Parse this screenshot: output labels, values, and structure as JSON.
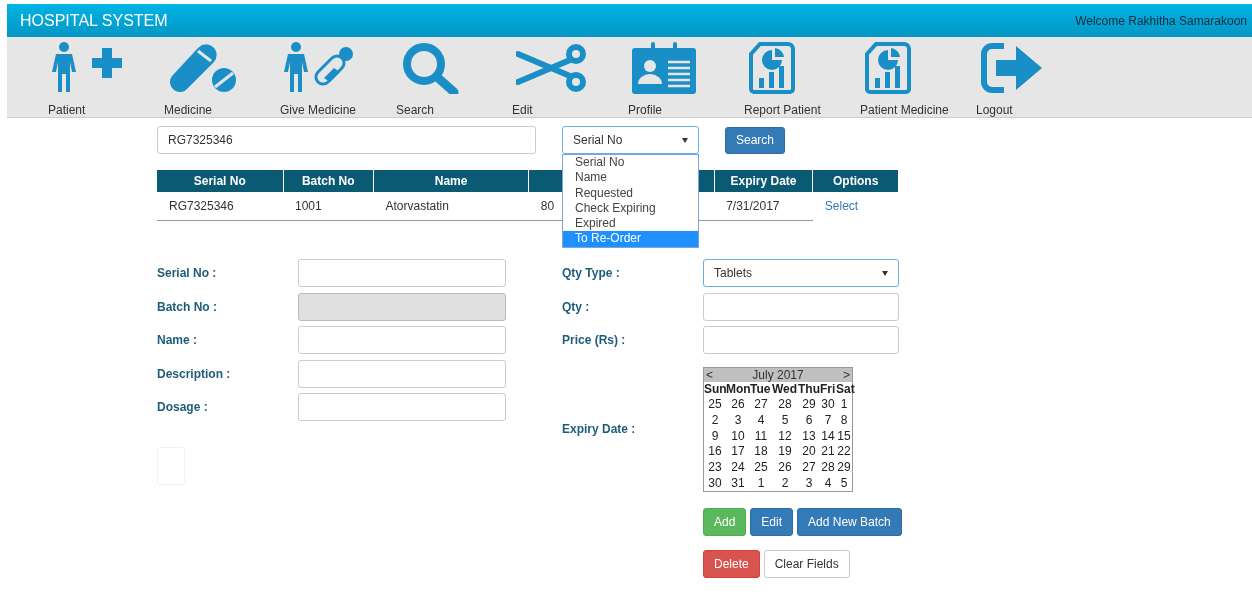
{
  "header": {
    "title": "HOSPITAL SYSTEM",
    "welcome": "Welcome Rakhitha Samarakoon"
  },
  "toolbar": [
    {
      "label": "Patient",
      "kind": "patient-add"
    },
    {
      "label": "Medicine",
      "kind": "pills"
    },
    {
      "label": "Give Medicine",
      "kind": "patient-pills"
    },
    {
      "label": "Search",
      "kind": "search"
    },
    {
      "label": "Edit",
      "kind": "scissors"
    },
    {
      "label": "Profile",
      "kind": "id-card"
    },
    {
      "label": "Report Patient",
      "kind": "report"
    },
    {
      "label": "Patient Medicine",
      "kind": "report"
    },
    {
      "label": "Logout",
      "kind": "logout"
    }
  ],
  "search": {
    "value": "RG7325346",
    "filter": "Serial No",
    "button": "Search",
    "options": [
      {
        "label": "Serial No",
        "selected": false
      },
      {
        "label": "Name",
        "selected": false
      },
      {
        "label": "Requested",
        "selected": false
      },
      {
        "label": "Check Expiring",
        "selected": false
      },
      {
        "label": "Expired",
        "selected": false
      },
      {
        "label": "To Re-Order",
        "selected": true
      }
    ]
  },
  "table": {
    "columns": [
      {
        "label": "Serial No"
      },
      {
        "label": "Batch No"
      },
      {
        "label": "Name"
      },
      {},
      {
        "label": "Expiry Date"
      },
      {
        "label": "Options"
      }
    ],
    "rows": [
      {
        "cells": [
          "RG7325346",
          "1001",
          "Atorvastatin",
          "80",
          "7/31/2017"
        ],
        "action": "Select"
      }
    ]
  },
  "form": {
    "left": [
      {
        "label": "Serial No :",
        "disabled": false
      },
      {
        "label": "Batch No :",
        "disabled": true
      },
      {
        "label": "Name :",
        "disabled": false
      },
      {
        "label": "Description :",
        "disabled": false
      },
      {
        "label": "Dosage :",
        "disabled": false
      }
    ],
    "qty_type": {
      "label": "Qty Type :",
      "value": "Tablets"
    },
    "right": [
      {
        "label": "Qty :"
      },
      {
        "label": "Price (Rs) :"
      }
    ],
    "expiry": {
      "label": "Expiry Date :"
    }
  },
  "calendar": {
    "prev": "<",
    "title": "July 2017",
    "next": ">",
    "weekdays": [
      "Sun",
      "Mon",
      "Tue",
      "Wed",
      "Thu",
      "Fri",
      "Sat"
    ],
    "weeks": [
      [
        "25",
        "26",
        "27",
        "28",
        "29",
        "30",
        "1"
      ],
      [
        "2",
        "3",
        "4",
        "5",
        "6",
        "7",
        "8"
      ],
      [
        "9",
        "10",
        "11",
        "12",
        "13",
        "14",
        "15"
      ],
      [
        "16",
        "17",
        "18",
        "19",
        "20",
        "21",
        "22"
      ],
      [
        "23",
        "24",
        "25",
        "26",
        "27",
        "28",
        "29"
      ],
      [
        "30",
        "31",
        "1",
        "2",
        "3",
        "4",
        "5"
      ]
    ]
  },
  "buttons": [
    [
      {
        "label": "Add",
        "kind": "success"
      },
      {
        "label": "Edit",
        "kind": "primary"
      },
      {
        "label": "Add New Batch",
        "kind": "primary"
      }
    ],
    [
      {
        "label": "Delete",
        "kind": "danger"
      },
      {
        "label": "Clear Fields",
        "kind": "default"
      }
    ]
  ]
}
